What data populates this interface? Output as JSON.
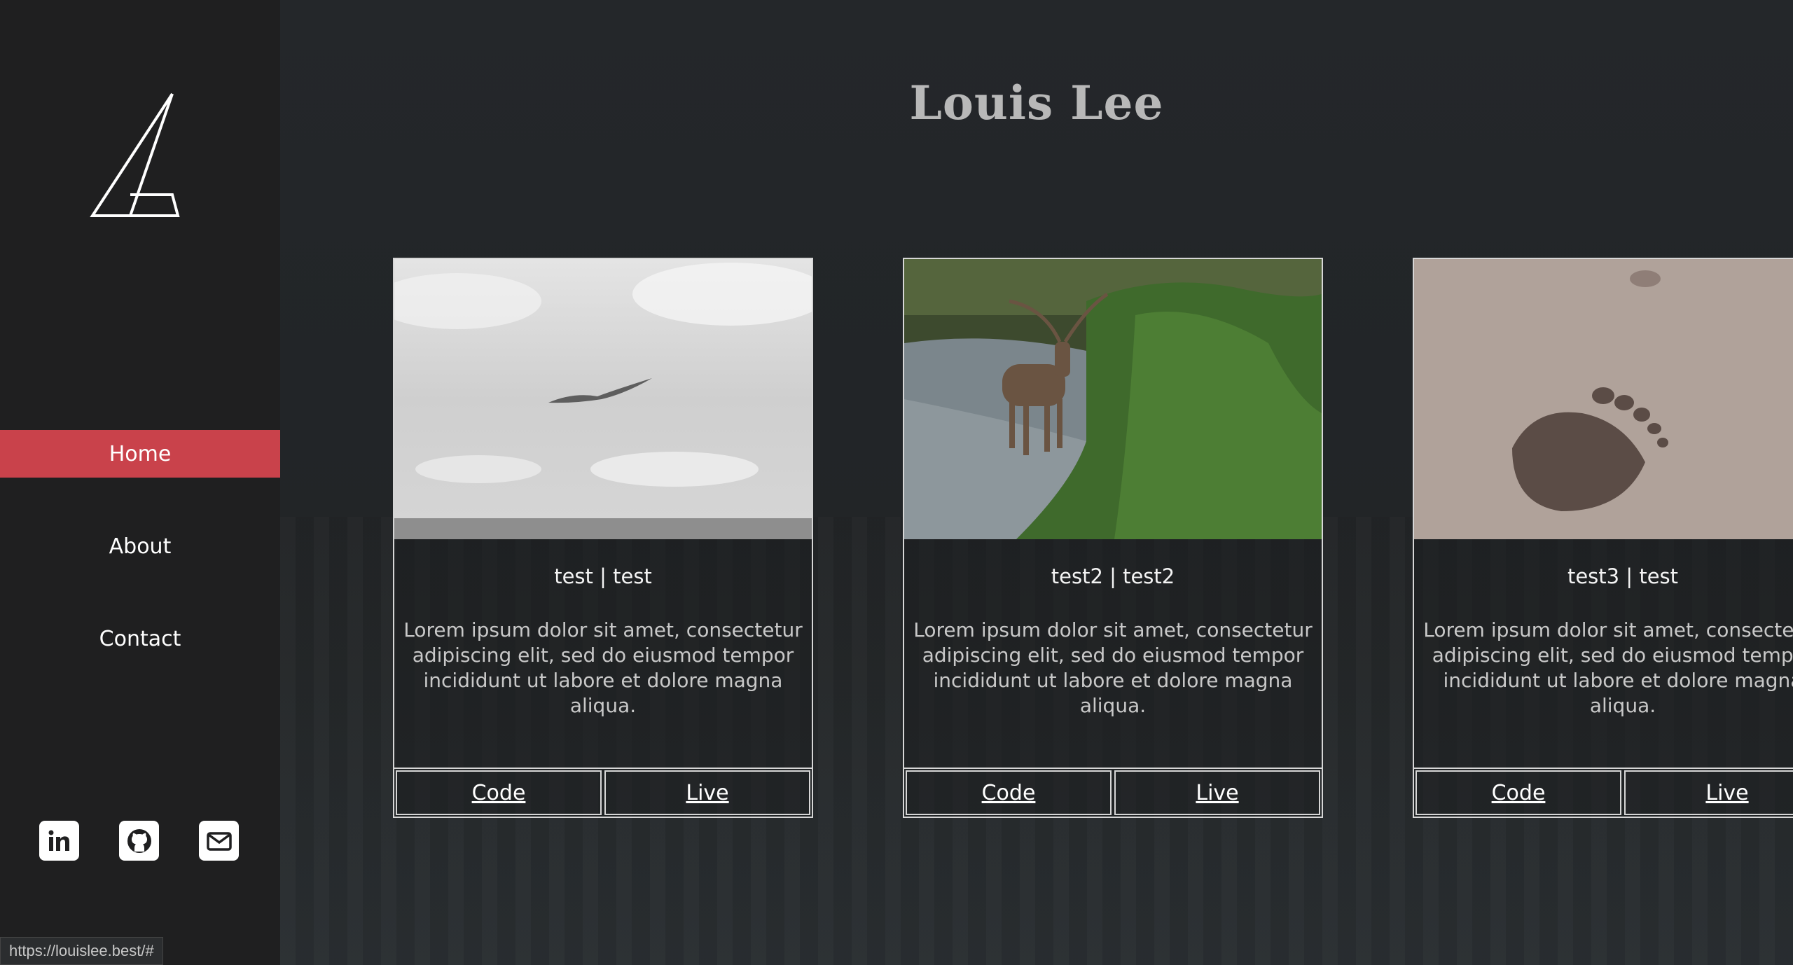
{
  "site": {
    "title": "Louis Lee"
  },
  "sidebar": {
    "nav": [
      {
        "label": "Home",
        "active": true
      },
      {
        "label": "About",
        "active": false
      },
      {
        "label": "Contact",
        "active": false
      }
    ],
    "social": [
      "linkedin-icon",
      "github-icon",
      "email-icon"
    ]
  },
  "projects": [
    {
      "title": "test | test",
      "description": "Lorem ipsum dolor sit amet, consectetur adipiscing elit, sed do eiusmod tempor incididunt ut labore et dolore magna aliqua.",
      "code_label": "Code",
      "live_label": "Live"
    },
    {
      "title": "test2 | test2",
      "description": "Lorem ipsum dolor sit amet, consectetur adipiscing elit, sed do eiusmod tempor incididunt ut labore et dolore magna aliqua.",
      "code_label": "Code",
      "live_label": "Live"
    },
    {
      "title": "test3 | test",
      "description": "Lorem ipsum dolor sit amet, consectetur adipiscing elit, sed do eiusmod tempor incididunt ut labore et dolore magna aliqua.",
      "code_label": "Code",
      "live_label": "Live"
    }
  ],
  "status_bar": {
    "url": "https://louislee.best/#"
  },
  "colors": {
    "accent": "#c9424b",
    "sidebar_bg": "#1f1f20"
  }
}
